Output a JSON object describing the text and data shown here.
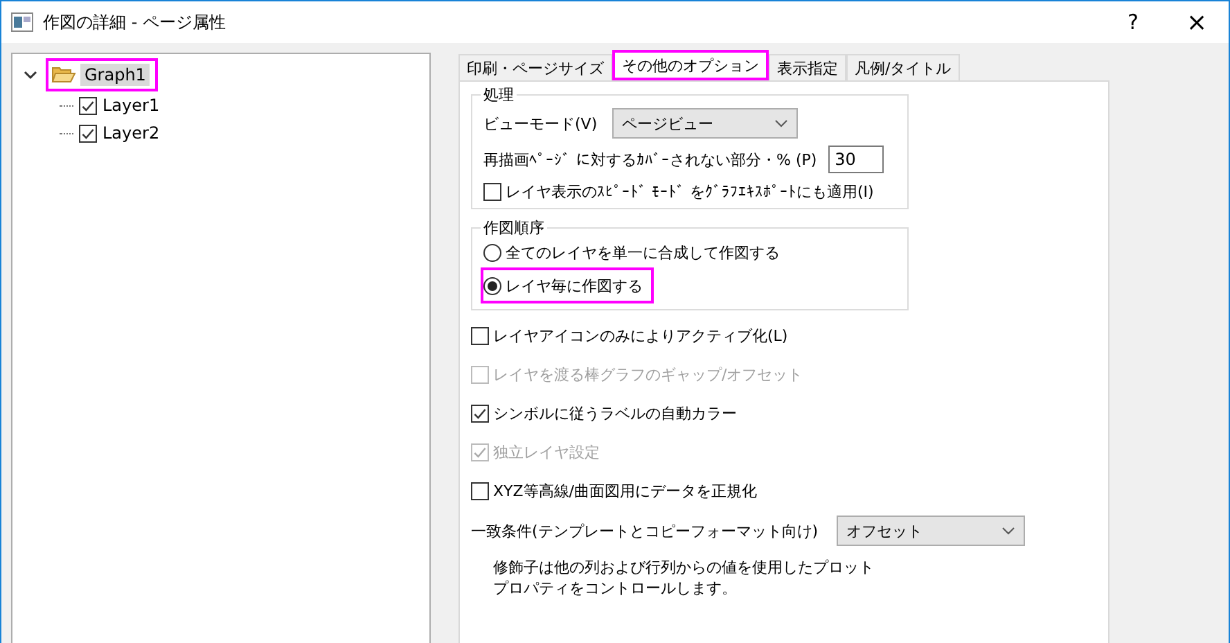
{
  "window": {
    "title": "作図の詳細 - ページ属性",
    "help": "?",
    "close": "×"
  },
  "tree": {
    "label": "Graph1",
    "expanded": true,
    "highlighted": true,
    "selected": true,
    "children": [
      {
        "label": "Layer1",
        "checked": true
      },
      {
        "label": "Layer2",
        "checked": true
      }
    ]
  },
  "tabs": [
    {
      "label": "印刷・ページサイズ",
      "selected": false,
      "highlighted": false
    },
    {
      "label": "その他のオプション",
      "selected": true,
      "highlighted": true
    },
    {
      "label": "表示指定",
      "selected": false,
      "highlighted": false
    },
    {
      "label": "凡例/タイトル",
      "selected": false,
      "highlighted": false
    }
  ],
  "processing": {
    "title": "処理",
    "view_mode_label": "ビューモード(V)",
    "view_mode_value": "ページビュー",
    "redraw_label": "再描画ﾍﾟｰｼﾞ に対するｶﾊﾞｰされない部分・% (P)",
    "redraw_value": "30",
    "speed_mode": {
      "label": "レイヤ表示のｽﾋﾟｰﾄﾞ ﾓｰﾄﾞ をｸﾞﾗﾌｴｷｽﾎﾟｰﾄにも適用(I)",
      "checked": false,
      "disabled": false
    }
  },
  "draw_order": {
    "title": "作図順序",
    "options": [
      {
        "label": "全てのレイヤを単一に合成して作図する",
        "selected": false,
        "highlighted": false
      },
      {
        "label": "レイヤ毎に作図する",
        "selected": true,
        "highlighted": true
      }
    ]
  },
  "options": [
    {
      "label": "レイヤアイコンのみによりアクティブ化(L)",
      "checked": false,
      "disabled": false
    },
    {
      "label": "レイヤを渡る棒グラフのギャップ/オフセット",
      "checked": false,
      "disabled": true
    },
    {
      "label": "シンボルに従うラベルの自動カラー",
      "checked": true,
      "disabled": false
    },
    {
      "label": "独立レイヤ設定",
      "checked": true,
      "disabled": true
    },
    {
      "label": "XYZ等高線/曲面図用にデータを正規化",
      "checked": false,
      "disabled": false
    }
  ],
  "match": {
    "label": "一致条件(テンプレートとコピーフォーマット向け)",
    "value": "オフセット"
  },
  "note": [
    "修飾子は他の列および行列からの値を使用したプロット",
    "プロパティをコントロールします。"
  ]
}
